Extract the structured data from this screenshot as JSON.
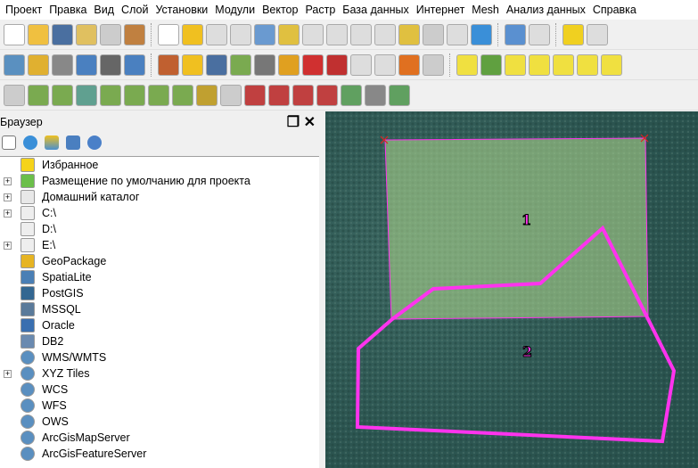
{
  "menu": [
    "Проект",
    "Правка",
    "Вид",
    "Слой",
    "Установки",
    "Модули",
    "Вектор",
    "Растр",
    "База данных",
    "Интернет",
    "Mesh",
    "Анализ данных",
    "Справка"
  ],
  "browser": {
    "title": "Браузер",
    "items": [
      {
        "label": "Избранное",
        "expandable": false,
        "icon": "star-icon",
        "color": "#f5d31a"
      },
      {
        "label": "Размещение по умолчанию для проекта",
        "expandable": true,
        "icon": "project-home-icon",
        "color": "#6bbf4a"
      },
      {
        "label": "Домашний каталог",
        "expandable": true,
        "icon": "home-folder-icon",
        "color": "#e8e8e8"
      },
      {
        "label": "C:\\",
        "expandable": true,
        "icon": "drive-icon",
        "color": "#eeeeee"
      },
      {
        "label": "D:\\",
        "expandable": false,
        "icon": "drive-icon",
        "color": "#eeeeee"
      },
      {
        "label": "E:\\",
        "expandable": true,
        "icon": "drive-icon",
        "color": "#eeeeee"
      },
      {
        "label": "GeoPackage",
        "expandable": false,
        "icon": "geopackage-icon",
        "color": "#e6b422"
      },
      {
        "label": "SpatiaLite",
        "expandable": false,
        "icon": "spatialite-icon",
        "color": "#4a7fb5"
      },
      {
        "label": "PostGIS",
        "expandable": false,
        "icon": "postgis-icon",
        "color": "#336791"
      },
      {
        "label": "MSSQL",
        "expandable": false,
        "icon": "mssql-icon",
        "color": "#5a7a9a"
      },
      {
        "label": "Oracle",
        "expandable": false,
        "icon": "oracle-icon",
        "color": "#3a6fb0"
      },
      {
        "label": "DB2",
        "expandable": false,
        "icon": "db2-icon",
        "color": "#6a8ab0"
      },
      {
        "label": "WMS/WMTS",
        "expandable": false,
        "icon": "globe-icon",
        "color": "#5a8fc0"
      },
      {
        "label": "XYZ Tiles",
        "expandable": true,
        "icon": "globe-icon",
        "color": "#5a8fc0"
      },
      {
        "label": "WCS",
        "expandable": false,
        "icon": "globe-icon",
        "color": "#5a8fc0"
      },
      {
        "label": "WFS",
        "expandable": false,
        "icon": "globe-icon",
        "color": "#5a8fc0"
      },
      {
        "label": "OWS",
        "expandable": false,
        "icon": "globe-icon",
        "color": "#5a8fc0"
      },
      {
        "label": "ArcGisMapServer",
        "expandable": false,
        "icon": "globe-icon",
        "color": "#5a8fc0"
      },
      {
        "label": "ArcGisFeatureServer",
        "expandable": false,
        "icon": "globe-icon",
        "color": "#5a8fc0"
      }
    ]
  },
  "map": {
    "labels": [
      "1",
      "2"
    ],
    "outline_color": "#ff33ee",
    "fill_color": "#a8d08a"
  }
}
